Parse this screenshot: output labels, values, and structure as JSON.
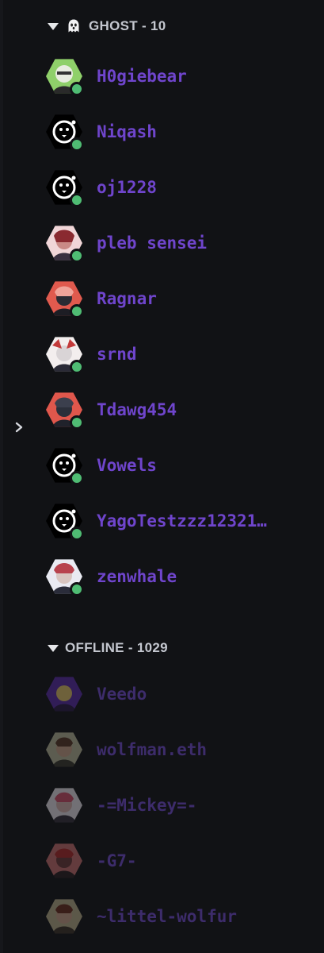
{
  "sections": {
    "online": {
      "title": "GHOST - 10",
      "emoji": "ghost-icon"
    },
    "offline": {
      "title": "OFFLINE - 1029"
    }
  },
  "online_members": [
    {
      "name": "H0giebear",
      "avatar": "green-art-avatar",
      "status": "online"
    },
    {
      "name": "Niqash",
      "avatar": "ghost-logo-avatar",
      "status": "online"
    },
    {
      "name": "oj1228",
      "avatar": "ghost-logo-avatar",
      "status": "online"
    },
    {
      "name": "pleb sensei",
      "avatar": "pink-art-avatar",
      "status": "online"
    },
    {
      "name": "Ragnar",
      "avatar": "red-art-avatar",
      "status": "online"
    },
    {
      "name": "srnd",
      "avatar": "white-red-art-avatar",
      "status": "online"
    },
    {
      "name": "Tdawg454",
      "avatar": "red-art-avatar",
      "status": "online"
    },
    {
      "name": "Vowels",
      "avatar": "ghost-logo-avatar",
      "status": "online"
    },
    {
      "name": "YagoTestzzz12321…",
      "avatar": "ghost-logo-avatar",
      "status": "online"
    },
    {
      "name": "zenwhale",
      "avatar": "white-art-avatar",
      "status": "online"
    }
  ],
  "offline_members": [
    {
      "name": "Veedo",
      "avatar": "purple-art-avatar"
    },
    {
      "name": "wolfman.eth",
      "avatar": "olive-art-avatar"
    },
    {
      "name": "-=Mickey=-",
      "avatar": "pink-art-avatar"
    },
    {
      "name": "-G7-",
      "avatar": "red-art-avatar"
    },
    {
      "name": "~littel-wolfur",
      "avatar": "olive-art-avatar"
    }
  ],
  "colors": {
    "background": "#111215",
    "name_online": "#6f45cc",
    "name_offline": "#3d2c6b",
    "status_online": "#4fbc73",
    "header_text": "#c4c7cf"
  }
}
